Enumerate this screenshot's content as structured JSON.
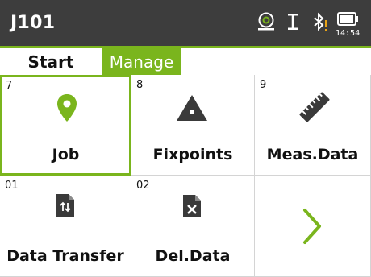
{
  "statusbar": {
    "title": "J101",
    "time": "14:54",
    "icons": [
      "prism-target-icon",
      "cursor-i-icon",
      "bluetooth-warning-icon",
      "battery-icon"
    ]
  },
  "tabs": [
    {
      "label": "Start",
      "active": false
    },
    {
      "label": "Manage",
      "active": true
    }
  ],
  "tiles": [
    {
      "number": "7",
      "label": "Job",
      "icon": "location-pin-icon",
      "selected": true
    },
    {
      "number": "8",
      "label": "Fixpoints",
      "icon": "triangle-fixpoint-icon",
      "selected": false
    },
    {
      "number": "9",
      "label": "Meas.Data",
      "icon": "ruler-icon",
      "selected": false
    },
    {
      "number": "01",
      "label": "Data Transfer",
      "icon": "file-transfer-icon",
      "selected": false
    },
    {
      "number": "02",
      "label": "Del.Data",
      "icon": "file-delete-icon",
      "selected": false
    },
    {
      "number": "",
      "label": "",
      "icon": "chevron-right-icon",
      "selected": false
    }
  ],
  "colors": {
    "accent": "#7ab51d",
    "statusbar_bg": "#3d3d3d",
    "icon_dark": "#3a3a3a",
    "warning": "#e8a317"
  }
}
